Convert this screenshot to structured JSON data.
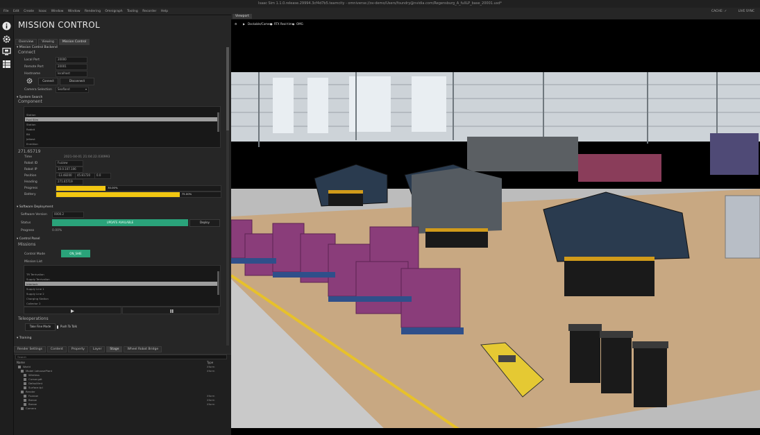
{
  "window": {
    "title": "Isaac Sim 1.1.0.release.29994.3cf4d7b5.teamcity - omniverse://ov-demo/Users/foundry@nvidia.com/Regensburg_A_fullLP_base_20001.usd*"
  },
  "menu": {
    "items": [
      "File",
      "Edit",
      "Create",
      "Isaac",
      "Window",
      "Window",
      "Rendering",
      "Omnigraph",
      "Tooling",
      "Recorder",
      "Help"
    ],
    "right_items": [
      "CACHE: ✓",
      "LIVE SYNC"
    ]
  },
  "panel": {
    "title": "MISSION CONTROL",
    "tabs": [
      "Overview",
      "Viewing",
      "Mission Control"
    ],
    "section_main": "Mission Control Backend",
    "connect": {
      "heading": "Connect",
      "local_port_label": "Local Port",
      "local_port": "20000",
      "remote_port_label": "Remote Port",
      "remote_port": "20001",
      "hostname_label": "Hostname",
      "hostname": "localhost",
      "connect_btn": "Connect",
      "disconnect_btn": "Disconnect",
      "camera_label": "Camera Selection",
      "camera_value": "Seafland"
    },
    "system_search": {
      "heading": "System Search",
      "component_heading": "Component",
      "components": [
        "Station",
        "Fuel Slim",
        "Station",
        "Rabbit",
        "BA",
        "Jelbest",
        "Enmition"
      ],
      "selected_index": 1
    },
    "details": {
      "heading": "271.65719",
      "time_label": "Time",
      "time": "2021-04-01 21:04:22.030993",
      "robot_id_label": "Robot ID",
      "robot_id": "Fuzzow",
      "robot_ip_label": "Robot IP",
      "robot_ip": "10.0.107.106",
      "position_label": "Position",
      "pos_x": "-13.48200",
      "pos_y": "45.81720",
      "pos_z": "0.0",
      "heading_label": "Heading",
      "progress_label": "Progress",
      "progress_pct": "30.00%",
      "progress_value": 0.3,
      "battery_label": "Battery",
      "battery_pct": "75.00%",
      "battery_value": 0.75
    },
    "software": {
      "heading": "Software Deployment",
      "version_label": "Software Version",
      "version": "0000.2",
      "status_label": "Status",
      "status": "UPDATE AVAILABLE",
      "deploy_btn": "Deploy",
      "progress_label": "Progress",
      "progress": "0.00%"
    },
    "control_panel": {
      "heading": "Control Panel",
      "missions_heading": "Missions",
      "control_mode_label": "Control Mode",
      "control_mode": "ON_SHIE",
      "mission_list_label": "Mission List",
      "missions": [
        "TR Terrivalion",
        "Supply Terrivalion",
        "Interlock",
        "Supply Line 1",
        "Supply Line 2",
        "Charging Station",
        "Collector 2"
      ],
      "selected_index": 2,
      "play_icon": "play-icon",
      "pause_icon": "pause-icon"
    },
    "teleop": {
      "heading": "Teleoperations",
      "take_btn": "Take Fine Mode",
      "push_btn": "Push To Talk"
    },
    "training": {
      "heading": "Training"
    }
  },
  "stage": {
    "tabs": [
      "Render Settings",
      "Content",
      "Property",
      "Layer",
      "Stage",
      "Wheel Robot Bridge"
    ],
    "search_placeholder": "Search",
    "col_name": "Name",
    "col_type": "Type",
    "rows": [
      {
        "name": "World",
        "type": "Xform"
      },
      {
        "name": "Model LahousePlant",
        "type": "Xform"
      },
      {
        "name": "Wireless",
        "type": ""
      },
      {
        "name": "Cursor.gdt",
        "type": ""
      },
      {
        "name": "Defaultlmt",
        "type": ""
      },
      {
        "name": "Surface.tpl",
        "type": ""
      },
      {
        "name": "Render",
        "type": ""
      },
      {
        "name": "Fuzzow",
        "type": "Xform"
      },
      {
        "name": "Barow",
        "type": "Xform"
      },
      {
        "name": "Barow",
        "type": "Xform"
      },
      {
        "name": "Camera",
        "type": ""
      }
    ]
  },
  "viewport": {
    "tab": "Viewport",
    "toolbar": [
      "Dockable/Camera",
      "RTX Real-time",
      "OMG"
    ]
  }
}
